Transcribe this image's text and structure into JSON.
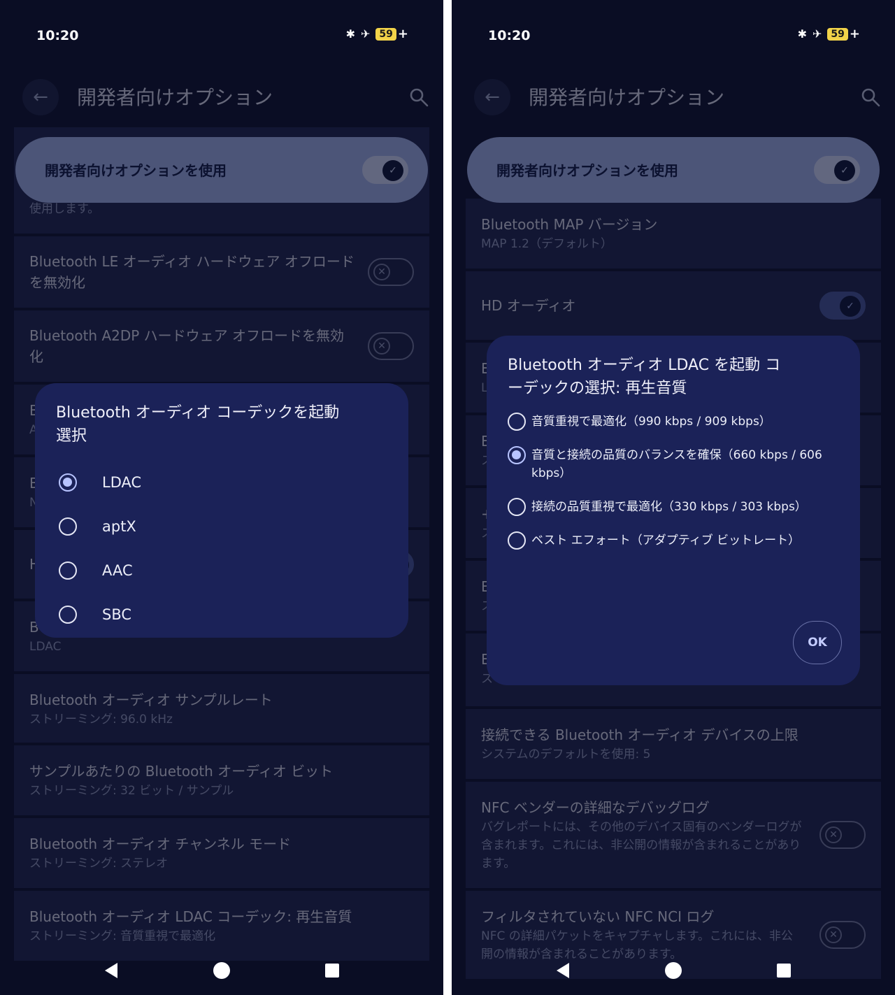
{
  "left": {
    "status": {
      "time": "10:20",
      "battery": "59"
    },
    "appbar": {
      "title": "開発者向けオプション"
    },
    "master": {
      "label": "開発者向けオプションを使用"
    },
    "rows": [
      {
        "title": "",
        "subtitle": "使用します。"
      },
      {
        "title": "Bluetooth LE オーディオ ハードウェア オフロードを無効化",
        "subtitle": ""
      },
      {
        "title": "Bluetooth A2DP ハードウェア オフロードを無効化",
        "subtitle": ""
      },
      {
        "title": "B",
        "subtitle": "A"
      },
      {
        "title": "B",
        "subtitle": "N"
      },
      {
        "title": "H",
        "subtitle": ""
      },
      {
        "title": "B",
        "subtitle": "LDAC"
      },
      {
        "title": "Bluetooth オーディオ サンプルレート",
        "subtitle": "ストリーミング: 96.0 kHz"
      },
      {
        "title": "サンプルあたりの Bluetooth オーディオ ビット",
        "subtitle": "ストリーミング: 32 ビット / サンプル"
      },
      {
        "title": "Bluetooth オーディオ チャンネル モード",
        "subtitle": "ストリーミング: ステレオ"
      },
      {
        "title": "Bluetooth オーディオ LDAC コーデック: 再生音質",
        "subtitle": "ストリーミング: 音質重視で最適化"
      }
    ],
    "dialog": {
      "title": "Bluetooth オーディオ コーデックを起動 選択",
      "options": [
        {
          "label": "LDAC",
          "selected": true
        },
        {
          "label": "aptX",
          "selected": false
        },
        {
          "label": "AAC",
          "selected": false
        },
        {
          "label": "SBC",
          "selected": false
        }
      ]
    }
  },
  "right": {
    "status": {
      "time": "10:20",
      "battery": "59"
    },
    "appbar": {
      "title": "開発者向けオプション"
    },
    "master": {
      "label": "開発者向けオプションを使用"
    },
    "rows": [
      {
        "title": "Bluetooth MAP バージョン",
        "subtitle": "MAP 1.2（デフォルト）"
      },
      {
        "title": "HD オーディオ",
        "subtitle": ""
      },
      {
        "title": "E",
        "subtitle": "L"
      },
      {
        "title": "E",
        "subtitle": "ス"
      },
      {
        "title": "+",
        "subtitle": "ス"
      },
      {
        "title": "E",
        "subtitle": "ス"
      },
      {
        "title": "E",
        "subtitle": "ス"
      },
      {
        "title": "接続できる Bluetooth オーディオ デバイスの上限",
        "subtitle": "システムのデフォルトを使用: 5"
      },
      {
        "title": "NFC ベンダーの詳細なデバッグログ",
        "subtitle": "バグレポートには、その他のデバイス固有のベンダーログが含まれます。これには、非公開の情報が含まれることがあります。"
      },
      {
        "title": "フィルタされていない NFC NCI ログ",
        "subtitle": "NFC の詳細パケットをキャプチャします。これには、非公開の情報が含まれることがあります。"
      }
    ],
    "dialog": {
      "title": "Bluetooth オーディオ LDAC を起動 コーデックの選択: 再生音質",
      "options": [
        {
          "label": "音質重視で最適化（990 kbps / 909 kbps）",
          "selected": false
        },
        {
          "label": "音質と接続の品質のバランスを確保（660 kbps / 606 kbps）",
          "selected": true
        },
        {
          "label": "接続の品質重視で最適化（330 kbps / 303 kbps）",
          "selected": false
        },
        {
          "label": "ベスト エフォート（アダプティブ ビットレート）",
          "selected": false
        }
      ],
      "ok_label": "OK"
    }
  }
}
